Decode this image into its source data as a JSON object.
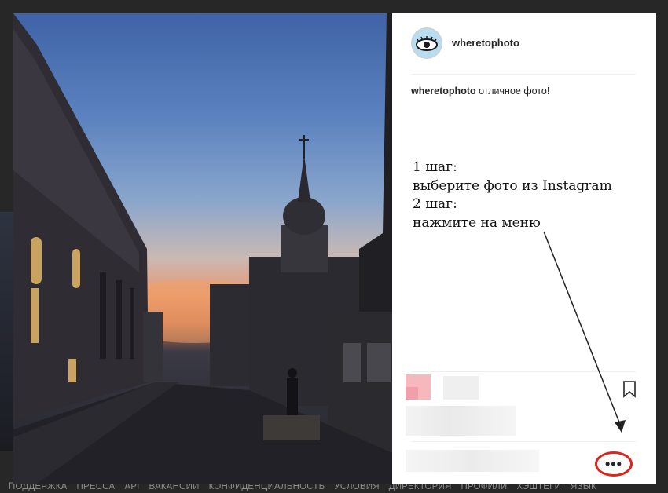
{
  "post": {
    "username": "wheretophoto",
    "caption_user": "wheretophoto",
    "caption_text": "отличное фото!"
  },
  "note": {
    "line1": "1 шаг:",
    "line2": "выберите фото из Instagram",
    "line3": "2 шаг:",
    "line4": "нажмите на меню"
  },
  "more_button": {
    "label": "•••"
  },
  "footer": {
    "items": [
      "ПОДДЕРЖКА",
      "ПРЕССА",
      "API",
      "ВАКАНСИИ",
      "КОНФИДЕНЦИАЛЬНОСТЬ",
      "УСЛОВИЯ",
      "ДИРЕКТОРИЯ",
      "ПРОФИЛИ",
      "ХЭШТЕГИ",
      "ЯЗЫК"
    ]
  },
  "colors": {
    "highlight_ring": "#e0241b",
    "avatar_bg": "#b9dcef"
  },
  "icons": [
    "eye-logo-icon",
    "bookmark-icon",
    "more-options-icon",
    "arrow-annotation"
  ]
}
